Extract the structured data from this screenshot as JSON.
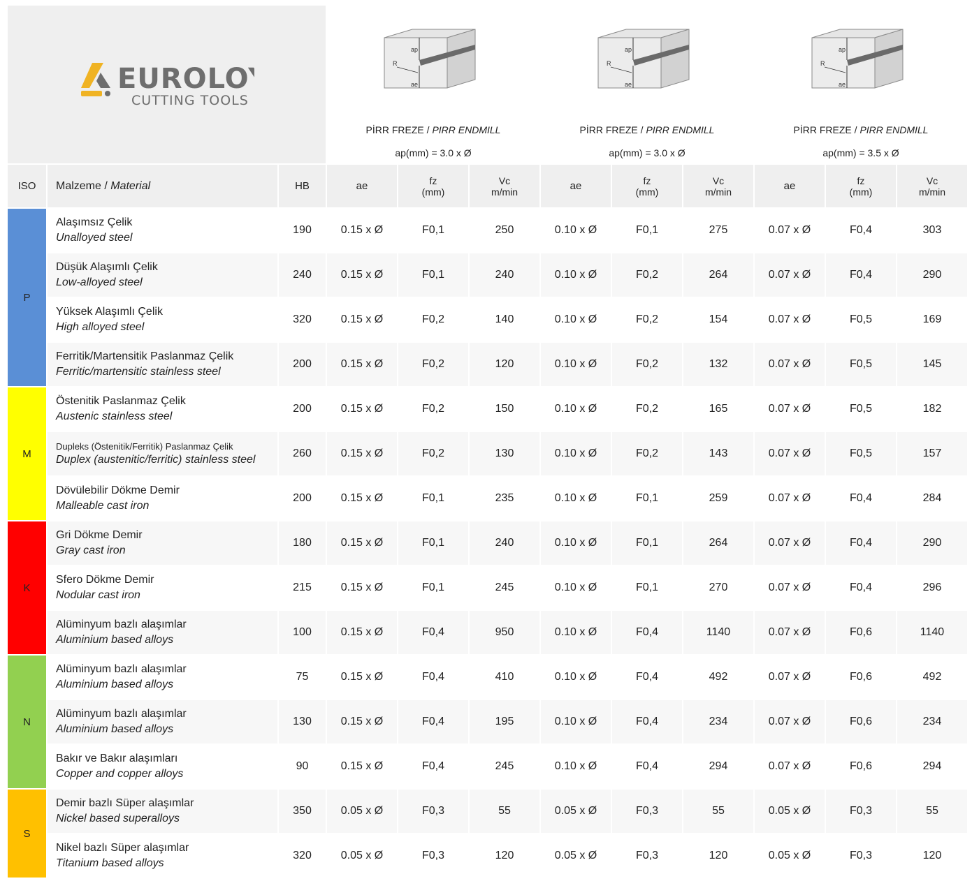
{
  "brand": {
    "logo_main": "EUROLOY",
    "logo_sub": "CUTTING TOOLS",
    "accent": "#f0b323",
    "gray": "#6e6e6e"
  },
  "figure_labels": {
    "ap": "ap",
    "r": "R",
    "ae": "ae"
  },
  "tools": [
    {
      "name_tr": "PİRR FREZE / ",
      "name_en": "PIRR ENDMILL",
      "depth": "ap(mm) = 3.0 x Ø"
    },
    {
      "name_tr": "PİRR FREZE / ",
      "name_en": "PIRR ENDMILL",
      "depth": "ap(mm) = 3.0 x Ø"
    },
    {
      "name_tr": "PİRR FREZE / ",
      "name_en": "PIRR ENDMILL",
      "depth": "ap(mm) = 3.5 x Ø"
    }
  ],
  "header": {
    "iso": "ISO",
    "material_tr": "Malzeme / ",
    "material_en": "Material",
    "hb": "HB",
    "ae": "ae",
    "fz_line1": "fz",
    "fz_line2": "(mm)",
    "vc_line1": "Vc",
    "vc_line2": "m/min"
  },
  "iso_colors": {
    "P": "#5a8fd6",
    "M": "#ffff00",
    "K": "#ff0000",
    "N": "#92d050",
    "S": "#ffc000"
  },
  "iso_groups": [
    {
      "code": "P",
      "rows": 4
    },
    {
      "code": "M",
      "rows": 3
    },
    {
      "code": "K",
      "rows": 3
    },
    {
      "code": "N",
      "rows": 3
    },
    {
      "code": "S",
      "rows": 2
    }
  ],
  "rows": [
    {
      "tr": "Alaşımsız Çelik",
      "en": "Unalloyed steel",
      "hb": "190",
      "c": [
        "0.15 x Ø",
        "F0,1",
        "250",
        "0.10 x Ø",
        "F0,1",
        "275",
        "0.07 x Ø",
        "F0,4",
        "303"
      ]
    },
    {
      "tr": "Düşük Alaşımlı Çelik",
      "en": "Low-alloyed steel",
      "hb": "240",
      "c": [
        "0.15 x Ø",
        "F0,1",
        "240",
        "0.10 x Ø",
        "F0,2",
        "264",
        "0.07 x Ø",
        "F0,4",
        "290"
      ]
    },
    {
      "tr": "Yüksek Alaşımlı Çelik",
      "en": "High alloyed steel",
      "hb": "320",
      "c": [
        "0.15 x Ø",
        "F0,2",
        "140",
        "0.10 x Ø",
        "F0,2",
        "154",
        "0.07 x Ø",
        "F0,5",
        "169"
      ]
    },
    {
      "tr": "Ferritik/Martensitik Paslanmaz Çelik",
      "en": "Ferritic/martensitic stainless steel",
      "hb": "200",
      "c": [
        "0.15 x Ø",
        "F0,2",
        "120",
        "0.10 x Ø",
        "F0,2",
        "132",
        "0.07 x Ø",
        "F0,5",
        "145"
      ]
    },
    {
      "tr": "Östenitik Paslanmaz Çelik",
      "en": "Austenic stainless steel",
      "hb": "200",
      "c": [
        "0.15 x Ø",
        "F0,2",
        "150",
        "0.10 x Ø",
        "F0,2",
        "165",
        "0.07 x Ø",
        "F0,5",
        "182"
      ]
    },
    {
      "tr": "Dupleks (Östenitik/Ferritik) Paslanmaz Çelik",
      "en": "Duplex (austenitic/ferritic) stainless steel",
      "hb": "260",
      "small": true,
      "c": [
        "0.15 x Ø",
        "F0,2",
        "130",
        "0.10 x Ø",
        "F0,2",
        "143",
        "0.07 x Ø",
        "F0,5",
        "157"
      ]
    },
    {
      "tr": "Dövülebilir Dökme Demir",
      "en": "Malleable cast iron",
      "hb": "200",
      "c": [
        "0.15 x Ø",
        "F0,1",
        "235",
        "0.10 x Ø",
        "F0,1",
        "259",
        "0.07 x Ø",
        "F0,4",
        "284"
      ]
    },
    {
      "tr": "Gri Dökme Demir",
      "en": "Gray cast iron",
      "hb": "180",
      "c": [
        "0.15 x Ø",
        "F0,1",
        "240",
        "0.10 x Ø",
        "F0,1",
        "264",
        "0.07 x Ø",
        "F0,4",
        "290"
      ]
    },
    {
      "tr": "Sfero Dökme Demir",
      "en": "Nodular cast iron",
      "hb": "215",
      "c": [
        "0.15 x Ø",
        "F0,1",
        "245",
        "0.10 x Ø",
        "F0,1",
        "270",
        "0.07 x Ø",
        "F0,4",
        "296"
      ]
    },
    {
      "tr": "Alüminyum bazlı alaşımlar",
      "en": "Aluminium based alloys",
      "hb": "100",
      "c": [
        "0.15 x Ø",
        "F0,4",
        "950",
        "0.10 x Ø",
        "F0,4",
        "1140",
        "0.07 x Ø",
        "F0,6",
        "1140"
      ]
    },
    {
      "tr": "Alüminyum bazlı alaşımlar",
      "en": "Aluminium based alloys",
      "hb": "75",
      "c": [
        "0.15 x Ø",
        "F0,4",
        "410",
        "0.10 x Ø",
        "F0,4",
        "492",
        "0.07 x Ø",
        "F0,6",
        "492"
      ]
    },
    {
      "tr": "Alüminyum bazlı alaşımlar",
      "en": "Aluminium based alloys",
      "hb": "130",
      "c": [
        "0.15 x Ø",
        "F0,4",
        "195",
        "0.10 x Ø",
        "F0,4",
        "234",
        "0.07 x Ø",
        "F0,6",
        "234"
      ]
    },
    {
      "tr": "Bakır ve Bakır alaşımları",
      "en": "Copper and copper alloys",
      "hb": "90",
      "c": [
        "0.15 x Ø",
        "F0,4",
        "245",
        "0.10 x Ø",
        "F0,4",
        "294",
        "0.07 x Ø",
        "F0,6",
        "294"
      ]
    },
    {
      "tr": "Demir bazlı Süper alaşımlar",
      "en": "Nickel based superalloys",
      "hb": "350",
      "c": [
        "0.05 x Ø",
        "F0,3",
        "55",
        "0.05 x Ø",
        "F0,3",
        "55",
        "0.05 x Ø",
        "F0,3",
        "55"
      ]
    },
    {
      "tr": "Nikel bazlı Süper alaşımlar",
      "en": "Titanium based alloys",
      "hb": "320",
      "c": [
        "0.05 x Ø",
        "F0,3",
        "120",
        "0.05 x Ø",
        "F0,3",
        "120",
        "0.05 x Ø",
        "F0,3",
        "120"
      ]
    }
  ]
}
